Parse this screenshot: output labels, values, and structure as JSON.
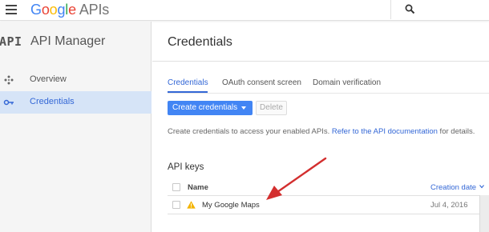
{
  "topbar": {
    "logo_google": "Google",
    "logo_apis": "APIs"
  },
  "sidebar": {
    "mark": "API",
    "title": "API Manager",
    "items": [
      {
        "label": "Overview",
        "icon": "overview-icon",
        "active": false
      },
      {
        "label": "Credentials",
        "icon": "key-icon",
        "active": true
      }
    ]
  },
  "main": {
    "title": "Credentials",
    "tabs": [
      {
        "label": "Credentials",
        "active": true
      },
      {
        "label": "OAuth consent screen",
        "active": false
      },
      {
        "label": "Domain verification",
        "active": false
      }
    ],
    "create_button": "Create credentials",
    "delete_button": "Delete",
    "info_text": "Create credentials to access your enabled APIs. ",
    "info_link": "Refer to the API documentation",
    "info_suffix": " for details.",
    "section_title": "API keys",
    "table": {
      "headers": {
        "name": "Name",
        "date": "Creation date"
      },
      "rows": [
        {
          "name": "My Google Maps",
          "date": "Jul 4, 2016",
          "status_icon": "warning-icon"
        }
      ]
    }
  },
  "colors": {
    "accent": "#4285f4",
    "link": "#3367d6",
    "sidebar_active": "#d6e4f7",
    "annotation_arrow": "#d32f2f",
    "warning": "#f4b400"
  }
}
